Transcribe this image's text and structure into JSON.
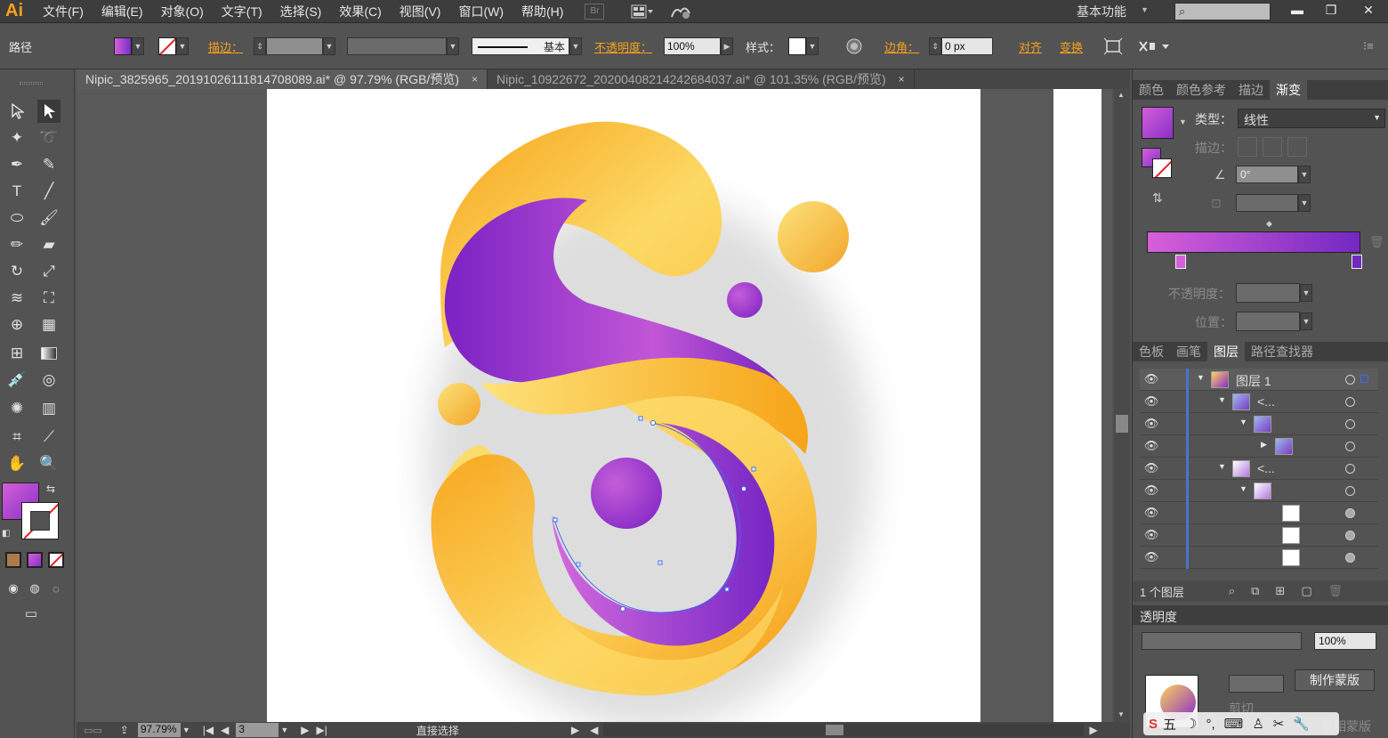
{
  "app": {
    "logo": "Ai"
  },
  "menu": [
    "文件(F)",
    "编辑(E)",
    "对象(O)",
    "文字(T)",
    "选择(S)",
    "效果(C)",
    "视图(V)",
    "窗口(W)",
    "帮助(H)"
  ],
  "menubar": {
    "bridge": "Br",
    "workspace": "基本功能"
  },
  "control": {
    "selection_label": "路径",
    "stroke_label": "描边：",
    "stroke_profile": "基本",
    "opacity_label": "不透明度：",
    "opacity_value": "100%",
    "style_label": "样式：",
    "corner_label": "边角：",
    "corner_value": "0 px",
    "align_label": "对齐",
    "transform_label": "变换"
  },
  "tabs": [
    {
      "label": "Nipic_3825965_20191026111814708089.ai* @ 97.79% (RGB/预览)",
      "close": "×"
    },
    {
      "label": "Nipic_10922672_20200408214242684037.ai* @ 101.35% (RGB/预览)",
      "close": "×"
    }
  ],
  "status": {
    "zoom": "97.79%",
    "artboard": "3",
    "tool": "直接选择"
  },
  "gradient_panel": {
    "tabs": [
      "颜色",
      "颜色参考",
      "描边",
      "渐变"
    ],
    "type_label": "类型：",
    "type_value": "线性",
    "stroke_label": "描边：",
    "angle_value": "0°",
    "opacity_label": "不透明度：",
    "position_label": "位置："
  },
  "layers_panel": {
    "tabs": [
      "色板",
      "画笔",
      "图层",
      "路径查找器"
    ],
    "rows": [
      {
        "label": "图层 1"
      },
      {
        "label": "<..."
      },
      {
        "label": ""
      },
      {
        "label": ""
      },
      {
        "label": "<..."
      },
      {
        "label": ""
      },
      {
        "label": ""
      },
      {
        "label": ""
      },
      {
        "label": ""
      }
    ],
    "footer": "1 个图层"
  },
  "transparency_panel": {
    "title": "透明度",
    "opacity_value": "100%",
    "make_mask": "制作蒙版",
    "clip_label": "剪切",
    "invert_label": "反相蒙版"
  },
  "colors": {
    "accent": "#f7a21b",
    "purple": "#8a2cc9",
    "magenta": "#c85bd6",
    "yellow": "#fbd35d",
    "orange": "#f6a417"
  }
}
